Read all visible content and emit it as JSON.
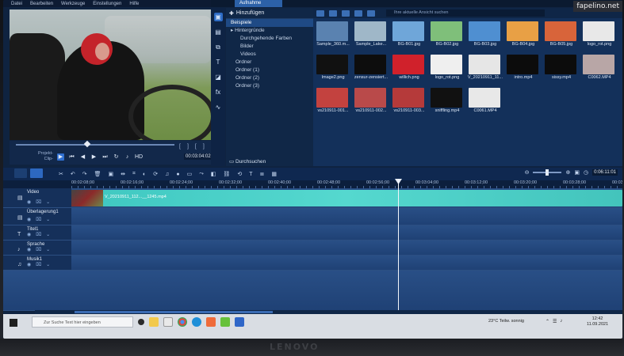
{
  "watermark": "fapelino.net",
  "monitor_brand": "LENOVO",
  "menu": [
    "Datei",
    "Bearbeiten",
    "Werkzeuge",
    "Einstellungen",
    "Hilfe"
  ],
  "top_tab": "Aufnahme",
  "preview": {
    "scrub_labels": [
      "Projekt-",
      "Clip-"
    ],
    "timecode": "00:03:04:02",
    "brackets": [
      "[",
      "]",
      "[",
      "]"
    ],
    "hd_label": "HD"
  },
  "sidebar_tools": [
    "media-icon",
    "video-icon",
    "audio-icon",
    "title-icon",
    "transition-icon",
    "fx-icon",
    "motion-icon"
  ],
  "tree": {
    "add_label": "Hinzufügen",
    "items": [
      {
        "label": "Beispiele",
        "indent": 0,
        "selected": true
      },
      {
        "label": "▸ Hintergründe",
        "indent": 0,
        "selected": false
      },
      {
        "label": "Durchgehende Farben",
        "indent": 2,
        "selected": false
      },
      {
        "label": "Bilder",
        "indent": 2,
        "selected": false
      },
      {
        "label": "Videos",
        "indent": 2,
        "selected": false
      },
      {
        "label": "Ordner",
        "indent": 1,
        "selected": false
      },
      {
        "label": "Ordner (1)",
        "indent": 1,
        "selected": false
      },
      {
        "label": "Ordner (2)",
        "indent": 1,
        "selected": false
      },
      {
        "label": "Ordner (3)",
        "indent": 1,
        "selected": false
      }
    ],
    "browse_label": "Durchsuchen"
  },
  "media": {
    "search_placeholder": "Ihre aktuelle Ansicht suchen",
    "items": [
      {
        "caption": "Sample_360.m...",
        "color": "#5a82b0"
      },
      {
        "caption": "Sample_Lake...",
        "color": "#9fb7c8"
      },
      {
        "caption": "BG-B01.jpg",
        "color": "#6fa6d9"
      },
      {
        "caption": "BG-B02.jpg",
        "color": "#7fbf7a"
      },
      {
        "caption": "BG-B03.jpg",
        "color": "#4f8fd1"
      },
      {
        "caption": "BG-B04.jpg",
        "color": "#e8a045"
      },
      {
        "caption": "BG-B05.jpg",
        "color": "#d8643a"
      },
      {
        "caption": "logo_rot.png",
        "color": "#e8e8e8"
      },
      {
        "caption": "Image2.png",
        "color": "#111111"
      },
      {
        "caption": "zensur-zensiert...",
        "color": "#0d0d0d"
      },
      {
        "caption": "willich.png",
        "color": "#d0212b"
      },
      {
        "caption": "logo_rot.png",
        "color": "#efefef"
      },
      {
        "caption": "V_20210911_11...",
        "color": "#e6e6e6"
      },
      {
        "caption": "intro.mp4",
        "color": "#0c0c0c"
      },
      {
        "caption": "sissy.mp4",
        "color": "#0c0c0c"
      },
      {
        "caption": "C0062.MP4",
        "color": "#b8a6a6"
      },
      {
        "caption": "vs210911-001...",
        "color": "#c3423f"
      },
      {
        "caption": "vs210911-002...",
        "color": "#b94a4a"
      },
      {
        "caption": "vs210911-003...",
        "color": "#b53a3a"
      },
      {
        "caption": "sniffling.mp4",
        "color": "#111111"
      },
      {
        "caption": "C0061.MP4",
        "color": "#e8e8e8"
      }
    ]
  },
  "timeline": {
    "ruler_labels": [
      "00:02:08;00",
      "00:02:16;00",
      "00:02:24;00",
      "00:02:32;00",
      "00:02:40;00",
      "00:02:48;00",
      "00:02:56;00",
      "00:03:04;00",
      "00:03:12;00",
      "00:03:20;00",
      "00:03:28;00",
      "00:03:36"
    ],
    "time_display": "0:06:11:01",
    "tracks": [
      {
        "name": "Video",
        "height": 25,
        "has_clip": true
      },
      {
        "name": "Überlagerung1",
        "height": 22,
        "has_clip": false
      },
      {
        "name": "Titel1",
        "height": 19,
        "has_clip": false
      },
      {
        "name": "Sprache",
        "height": 19,
        "has_clip": false
      },
      {
        "name": "Musik1",
        "height": 19,
        "has_clip": false
      }
    ],
    "clip_label": "V_20210911_112...__1245.mp4"
  },
  "taskbar": {
    "search_placeholder": "Zur Suche Text hier eingeben",
    "weather": "23°C  Teilw. sonnig",
    "time": "12:42",
    "date": "11.09.2021"
  }
}
